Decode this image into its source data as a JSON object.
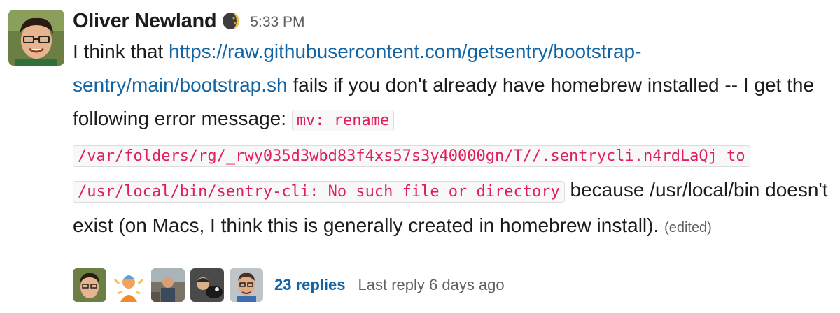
{
  "message": {
    "author": "Oliver Newland",
    "status_icon": "crescent-moon-icon",
    "time": "5:33 PM",
    "text_intro": "I think that ",
    "link": "https://raw.githubusercontent.com/getsentry/bootstrap-sentry/main/bootstrap.sh",
    "text_after_link": " fails if you don't already have homebrew installed -- I get the following error message: ",
    "code": "mv: rename /var/folders/rg/_rwy035d3wbd83f4xs57s3y40000gn/T//.sentrycli.n4rdLaQj to /usr/local/bin/sentry-cli: No such file or directory",
    "text_after_code": " because /usr/local/bin doesn't exist (on Macs, I think this is generally created in homebrew install). ",
    "edited": "(edited)"
  },
  "thread": {
    "replies": "23 replies",
    "last_reply": "Last reply 6 days ago"
  },
  "colors": {
    "link": "#1264a3",
    "code": "#e01e5a",
    "muted": "#616061"
  }
}
